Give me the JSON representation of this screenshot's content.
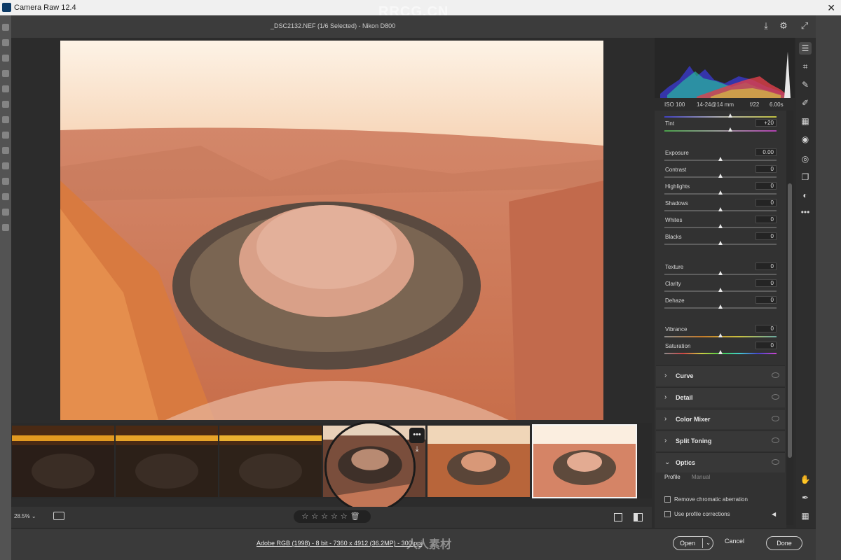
{
  "window": {
    "title": "Camera Raw 12.4",
    "close": "✕"
  },
  "watermark": {
    "top": "RRCG.CN",
    "bottom": "人人素材"
  },
  "header": {
    "file_info": "_DSC2132.NEF (1/6 Selected)  -  Nikon D800"
  },
  "exif": {
    "iso": "ISO 100",
    "lens": "14-24@14 mm",
    "aperture": "f/22",
    "shutter": "6.00s"
  },
  "sliders": [
    {
      "name": "temp",
      "label": "",
      "value": "",
      "pos": 0.59,
      "track": "temp"
    },
    {
      "name": "tint",
      "label": "Tint",
      "value": "+20",
      "pos": 0.59,
      "track": "tint"
    },
    {
      "name": "exposure",
      "label": "Exposure",
      "value": "0.00",
      "pos": 0.5,
      "track": ""
    },
    {
      "name": "contrast",
      "label": "Contrast",
      "value": "0",
      "pos": 0.5,
      "track": ""
    },
    {
      "name": "highlights",
      "label": "Highlights",
      "value": "0",
      "pos": 0.5,
      "track": ""
    },
    {
      "name": "shadows",
      "label": "Shadows",
      "value": "0",
      "pos": 0.5,
      "track": ""
    },
    {
      "name": "whites",
      "label": "Whites",
      "value": "0",
      "pos": 0.5,
      "track": ""
    },
    {
      "name": "blacks",
      "label": "Blacks",
      "value": "0",
      "pos": 0.5,
      "track": ""
    },
    {
      "name": "texture",
      "label": "Texture",
      "value": "0",
      "pos": 0.5,
      "track": ""
    },
    {
      "name": "clarity",
      "label": "Clarity",
      "value": "0",
      "pos": 0.5,
      "track": ""
    },
    {
      "name": "dehaze",
      "label": "Dehaze",
      "value": "0",
      "pos": 0.5,
      "track": ""
    },
    {
      "name": "vibrance",
      "label": "Vibrance",
      "value": "0",
      "pos": 0.5,
      "track": "vib"
    },
    {
      "name": "saturation",
      "label": "Saturation",
      "value": "0",
      "pos": 0.5,
      "track": "sat"
    }
  ],
  "sections": [
    {
      "label": "Curve",
      "chevron": "›"
    },
    {
      "label": "Detail",
      "chevron": "›"
    },
    {
      "label": "Color Mixer",
      "chevron": "›"
    },
    {
      "label": "Split Toning",
      "chevron": "›"
    },
    {
      "label": "Optics",
      "chevron": "⌄"
    }
  ],
  "optics": {
    "tabs": [
      "Profile",
      "Manual"
    ],
    "checks": [
      "Remove chromatic aberration",
      "Use profile corrections"
    ]
  },
  "filmstrip": {
    "count": 6,
    "selected_index": 5,
    "more_label": "•••"
  },
  "bottom": {
    "zoom": "28.5%",
    "rating": "☆☆☆☆☆"
  },
  "footer": {
    "workflow": "Adobe RGB (1998) - 8 bit - 7360 x 4912 (36.2MP) - 300 ppi",
    "open": "Open",
    "cancel": "Cancel",
    "done": "Done"
  },
  "colors": {
    "accent": "#f5f5f5",
    "panel": "#323232",
    "canyon": "#d98c5e"
  },
  "tools": [
    "edit-icon",
    "crop-icon",
    "heal-icon",
    "brush-icon",
    "gradient-icon",
    "radial-icon",
    "redeye-icon",
    "snapshot-icon",
    "preset-icon",
    "more-icon",
    "hand-icon",
    "sampler-icon",
    "grid-icon"
  ]
}
